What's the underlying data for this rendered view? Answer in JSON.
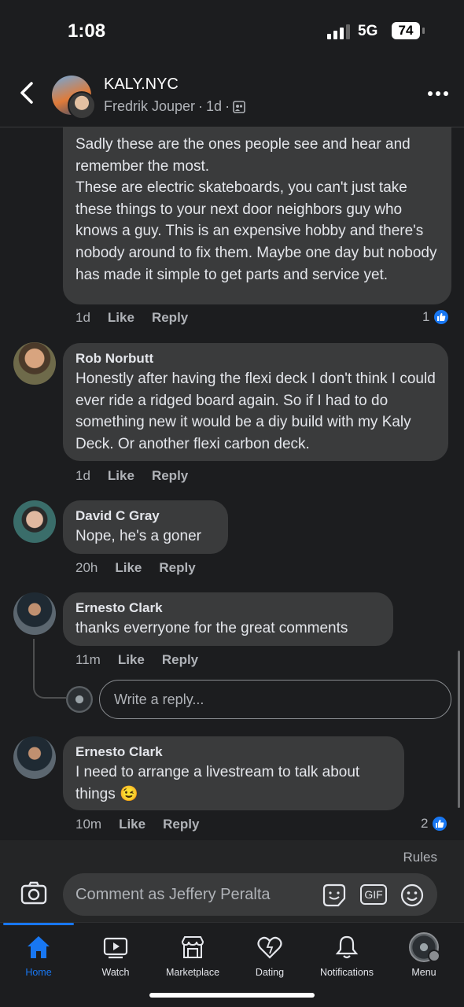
{
  "status": {
    "time": "1:08",
    "network": "5G",
    "battery": "74"
  },
  "header": {
    "page_name": "KALY.NYC",
    "author": "Fredrik Jouper",
    "age": "1d",
    "sep": "·"
  },
  "comments": [
    {
      "text": "Sadly these are the ones people see and hear and remember the most.\nThese are electric skateboards, you can't just take these things to your next door neighbors guy who knows a guy.  This is an expensive hobby and there's nobody around to fix them. Maybe one day but nobody has made it simple to get parts and service yet.",
      "time": "1d",
      "like": "Like",
      "reply": "Reply",
      "reactions": "1"
    },
    {
      "author": "Rob Norbutt",
      "text": "Honestly after having the flexi deck I don't think I could ever ride a ridged board again. So if I had to do something new it would be a diy build with my Kaly Deck. Or another flexi carbon deck.",
      "time": "1d",
      "like": "Like",
      "reply": "Reply"
    },
    {
      "author": "David C Gray",
      "text": "Nope, he's a goner",
      "time": "20h",
      "like": "Like",
      "reply": "Reply"
    },
    {
      "author": "Ernesto Clark",
      "text": "thanks everryone for the great comments",
      "time": "11m",
      "like": "Like",
      "reply": "Reply"
    },
    {
      "author": "Ernesto Clark",
      "text": "I need to arrange a livestream to talk about things 😉",
      "time": "10m",
      "like": "Like",
      "reply": "Reply",
      "reactions": "2"
    }
  ],
  "reply_box": {
    "placeholder": "Write a reply..."
  },
  "composer": {
    "rules": "Rules",
    "placeholder": "Comment as Jeffery Peralta",
    "gif": "GIF"
  },
  "tabs": [
    {
      "label": "Home",
      "icon": "home-icon",
      "active": true
    },
    {
      "label": "Watch",
      "icon": "watch-icon"
    },
    {
      "label": "Marketplace",
      "icon": "marketplace-icon"
    },
    {
      "label": "Dating",
      "icon": "dating-icon"
    },
    {
      "label": "Notifications",
      "icon": "bell-icon"
    },
    {
      "label": "Menu",
      "icon": "menu-avatar-icon"
    }
  ],
  "colors": {
    "background": "#1c1d1f",
    "bubble": "#3a3b3c",
    "accent": "#1877f2",
    "muted_text": "#b0b3b8"
  }
}
